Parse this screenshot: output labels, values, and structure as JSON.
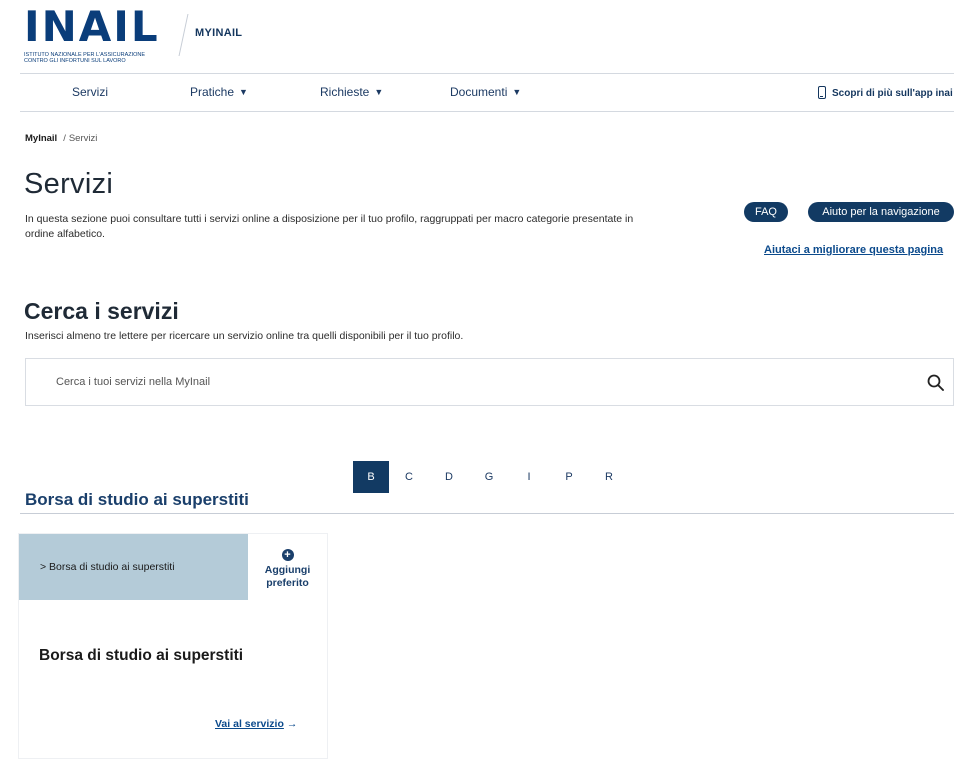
{
  "header": {
    "logo_word": "INAIL",
    "logo_sub_line1": "ISTITUTO NAZIONALE PER L'ASSICURAZIONE",
    "logo_sub_line2": "CONTRO GLI INFORTUNI SUL LAVORO",
    "app_name": "MYINAIL"
  },
  "nav": {
    "items": [
      {
        "label": "Servizi",
        "dropdown": false
      },
      {
        "label": "Pratiche",
        "dropdown": true
      },
      {
        "label": "Richieste",
        "dropdown": true
      },
      {
        "label": "Documenti",
        "dropdown": true
      }
    ],
    "caret": "▼",
    "app_link": "Scopri di più sull'app inai"
  },
  "breadcrumb": {
    "home": "MyInail",
    "separator": "/",
    "current": "Servizi"
  },
  "page": {
    "title": "Servizi",
    "description": "In questa sezione puoi consultare tutti i servizi online a disposizione per il tuo profilo, raggruppati per macro categorie presentate in ordine alfabetico.",
    "faq": "FAQ",
    "help": "Aiuto per la navigazione",
    "improve": "Aiutaci a migliorare questa pagina"
  },
  "search": {
    "title": "Cerca i servizi",
    "help": "Inserisci almeno tre lettere per ricercare un servizio online tra quelli disponibili per il tuo profilo.",
    "placeholder": "Cerca i tuoi servizi nella MyInail",
    "value": ""
  },
  "alphabet": {
    "letters": [
      "B",
      "C",
      "D",
      "G",
      "I",
      "P",
      "R"
    ],
    "active": "B"
  },
  "category": {
    "title": "Borsa di studio ai superstiti"
  },
  "card": {
    "head_label": "> Borsa di studio ai superstiti",
    "fav_icon": "+",
    "fav_label_1": "Aggiungi",
    "fav_label_2": "preferito",
    "title": "Borsa di studio ai superstiti",
    "link": "Vai al servizio",
    "arrow": "→"
  },
  "colors": {
    "primary": "#123a63",
    "card_header": "#b4cbd8",
    "link": "#0b4a8c",
    "logo_blue": "#0a3d7a"
  }
}
